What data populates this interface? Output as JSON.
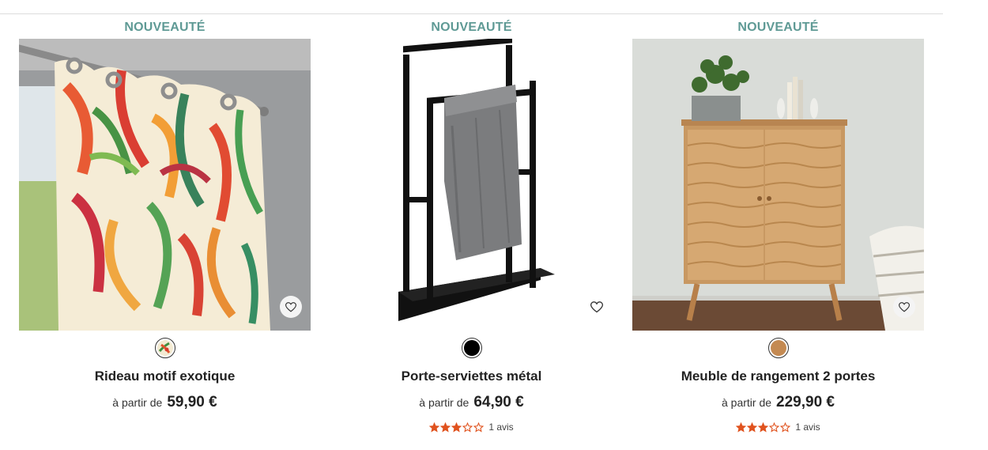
{
  "products": [
    {
      "badge": "NOUVEAUTÉ",
      "name": "Rideau motif exotique",
      "price_prefix": "à partir de",
      "price": "59,90 €",
      "swatch": "motif",
      "favorite_icon": "heart-icon"
    },
    {
      "badge": "NOUVEAUTÉ",
      "name": "Porte-serviettes métal",
      "price_prefix": "à partir de",
      "price": "64,90 €",
      "swatch_color": "#000000",
      "rating": 3,
      "rating_max": 5,
      "reviews": "1 avis",
      "favorite_icon": "heart-icon"
    },
    {
      "badge": "NOUVEAUTÉ",
      "name": "Meuble de rangement 2 portes",
      "price_prefix": "à partir de",
      "price": "229,90 €",
      "swatch_color": "#c48a52",
      "rating": 3,
      "rating_max": 5,
      "reviews": "1 avis",
      "favorite_icon": "heart-icon"
    }
  ],
  "colors": {
    "badge": "#5f9a95",
    "star": "#e0531f"
  }
}
